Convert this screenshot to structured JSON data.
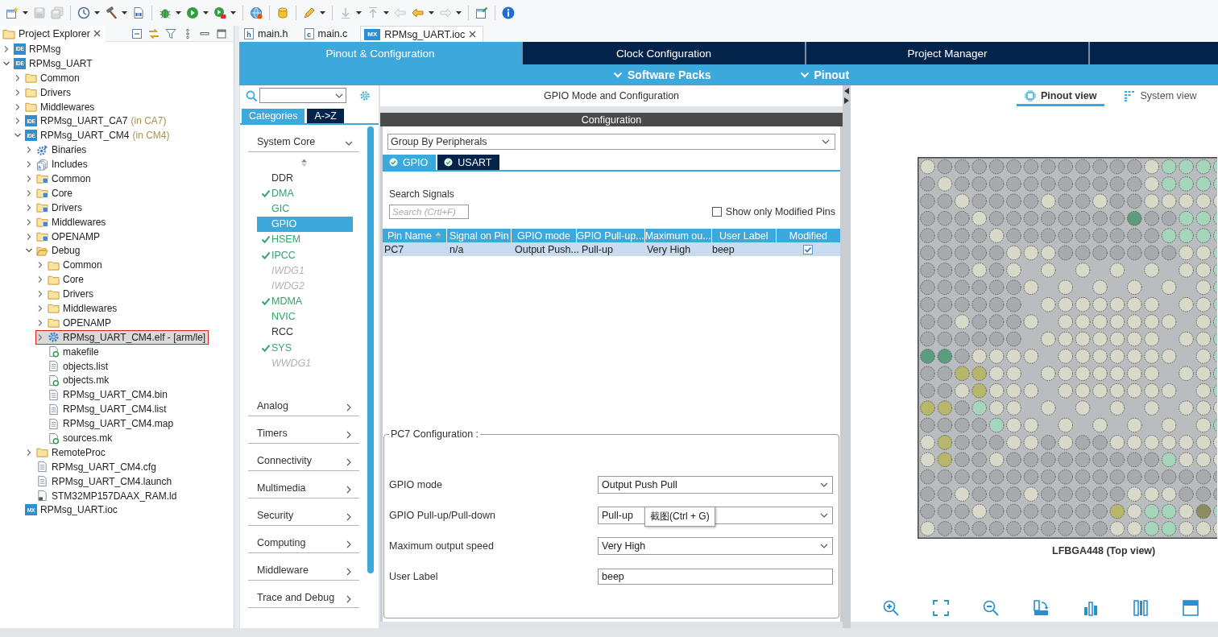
{
  "toolbar": [
    {
      "kind": "new",
      "dropdown": true,
      "disabled": false
    },
    {
      "kind": "save",
      "dropdown": false,
      "disabled": true
    },
    {
      "kind": "save-all",
      "dropdown": false,
      "disabled": true
    },
    {
      "kind": "separator"
    },
    {
      "kind": "target",
      "dropdown": true,
      "disabled": false
    },
    {
      "kind": "build",
      "dropdown": true,
      "disabled": false
    },
    {
      "kind": "binary",
      "dropdown": false,
      "disabled": false
    },
    {
      "kind": "separator"
    },
    {
      "kind": "debug",
      "dropdown": true,
      "disabled": false
    },
    {
      "kind": "run",
      "dropdown": true,
      "disabled": false
    },
    {
      "kind": "external",
      "dropdown": true,
      "disabled": false
    },
    {
      "kind": "separator"
    },
    {
      "kind": "globe",
      "dropdown": false,
      "disabled": false
    },
    {
      "kind": "separator"
    },
    {
      "kind": "mount",
      "dropdown": false,
      "disabled": false
    },
    {
      "kind": "separator"
    },
    {
      "kind": "wand",
      "dropdown": true,
      "disabled": false
    },
    {
      "kind": "separator"
    },
    {
      "kind": "step-down",
      "dropdown": true,
      "disabled": true
    },
    {
      "kind": "step-up",
      "dropdown": true,
      "disabled": true
    },
    {
      "kind": "back-edit",
      "dropdown": false,
      "disabled": true
    },
    {
      "kind": "back",
      "dropdown": true,
      "disabled": false
    },
    {
      "kind": "forward",
      "dropdown": true,
      "disabled": true
    },
    {
      "kind": "separator"
    },
    {
      "kind": "window",
      "dropdown": false,
      "disabled": false
    },
    {
      "kind": "separator"
    },
    {
      "kind": "info",
      "dropdown": false,
      "disabled": false
    }
  ],
  "explorer": {
    "title": "Project Explorer",
    "items": [
      {
        "label": "RPMsg",
        "kind": "project",
        "badge": "IDE",
        "expanded": false,
        "selected": false,
        "outlined": false
      },
      {
        "label": "RPMsg_UART",
        "kind": "project",
        "badge": "IDE",
        "expanded": true,
        "selected": false,
        "outlined": false,
        "children": [
          {
            "label": "Common",
            "kind": "folder",
            "expanded": false,
            "selected": false,
            "outlined": false
          },
          {
            "label": "Drivers",
            "kind": "folder",
            "expanded": false,
            "selected": false,
            "outlined": false
          },
          {
            "label": "Middlewares",
            "kind": "folder",
            "expanded": false,
            "selected": false,
            "outlined": false
          },
          {
            "label": "RPMsg_UART_CA7",
            "note": "(in CA7)",
            "kind": "project",
            "badge": "IDE",
            "expanded": false,
            "selected": false,
            "outlined": false
          },
          {
            "label": "RPMsg_UART_CM4",
            "note": "(in CM4)",
            "kind": "project",
            "badge": "IDE",
            "expanded": true,
            "selected": false,
            "outlined": false,
            "children": [
              {
                "label": "Binaries",
                "kind": "binaries",
                "expanded": false,
                "selected": false,
                "outlined": false
              },
              {
                "label": "Includes",
                "kind": "includes",
                "expanded": false,
                "selected": false,
                "outlined": false
              },
              {
                "label": "Common",
                "kind": "source-folder",
                "expanded": false,
                "selected": false,
                "outlined": false
              },
              {
                "label": "Core",
                "kind": "source-folder",
                "expanded": false,
                "selected": false,
                "outlined": false
              },
              {
                "label": "Drivers",
                "kind": "source-folder",
                "expanded": false,
                "selected": false,
                "outlined": false
              },
              {
                "label": "Middlewares",
                "kind": "source-folder",
                "expanded": false,
                "selected": false,
                "outlined": false
              },
              {
                "label": "OPENAMP",
                "kind": "source-folder",
                "expanded": false,
                "selected": false,
                "outlined": false
              },
              {
                "label": "Debug",
                "kind": "folder",
                "expanded": true,
                "selected": false,
                "outlined": false,
                "children": [
                  {
                    "label": "Common",
                    "kind": "folder",
                    "expanded": false,
                    "selected": false,
                    "outlined": false
                  },
                  {
                    "label": "Core",
                    "kind": "folder",
                    "expanded": false,
                    "selected": false,
                    "outlined": false
                  },
                  {
                    "label": "Drivers",
                    "kind": "folder",
                    "expanded": false,
                    "selected": false,
                    "outlined": false
                  },
                  {
                    "label": "Middlewares",
                    "kind": "folder",
                    "expanded": false,
                    "selected": false,
                    "outlined": false
                  },
                  {
                    "label": "OPENAMP",
                    "kind": "folder",
                    "expanded": false,
                    "selected": false,
                    "outlined": false
                  },
                  {
                    "label": "RPMsg_UART_CM4.elf - [arm/le]",
                    "kind": "binary",
                    "expanded": false,
                    "selected": true,
                    "outlined": true
                  },
                  {
                    "label": "makefile",
                    "kind": "make-file",
                    "expanded": false,
                    "selected": false,
                    "outlined": false
                  },
                  {
                    "label": "objects.list",
                    "kind": "text-file",
                    "expanded": false,
                    "selected": false,
                    "outlined": false
                  },
                  {
                    "label": "objects.mk",
                    "kind": "make-file",
                    "expanded": false,
                    "selected": false,
                    "outlined": false
                  },
                  {
                    "label": "RPMsg_UART_CM4.bin",
                    "kind": "text-file",
                    "expanded": false,
                    "selected": false,
                    "outlined": false
                  },
                  {
                    "label": "RPMsg_UART_CM4.list",
                    "kind": "text-file",
                    "expanded": false,
                    "selected": false,
                    "outlined": false
                  },
                  {
                    "label": "RPMsg_UART_CM4.map",
                    "kind": "text-file",
                    "expanded": false,
                    "selected": false,
                    "outlined": false
                  },
                  {
                    "label": "sources.mk",
                    "kind": "make-file",
                    "expanded": false,
                    "selected": false,
                    "outlined": false
                  }
                ]
              },
              {
                "label": "RemoteProc",
                "kind": "folder",
                "expanded": false,
                "selected": false,
                "outlined": false
              },
              {
                "label": "RPMsg_UART_CM4.cfg",
                "kind": "text-file",
                "expanded": false,
                "selected": false,
                "outlined": false
              },
              {
                "label": "RPMsg_UART_CM4.launch",
                "kind": "text-file",
                "expanded": false,
                "selected": false,
                "outlined": false
              },
              {
                "label": "STM32MP157DAAX_RAM.ld",
                "kind": "linker-file",
                "expanded": false,
                "selected": false,
                "outlined": false
              }
            ]
          },
          {
            "label": "RPMsg_UART.ioc",
            "kind": "mx-file",
            "badge": "MX",
            "expanded": false,
            "selected": false,
            "outlined": false
          }
        ]
      }
    ]
  },
  "editor_tabs": [
    {
      "label": "main.h",
      "kind": "doc",
      "badge": "h",
      "selected": false
    },
    {
      "label": "main.c",
      "kind": "doc",
      "badge": "c",
      "selected": false
    },
    {
      "label": "RPMsg_UART.ioc",
      "kind": "tile",
      "badge": "MX",
      "selected": true
    }
  ],
  "perspective_tabs": [
    {
      "label": "Pinout & Configuration",
      "selected": true
    },
    {
      "label": "Clock Configuration",
      "selected": false
    },
    {
      "label": "Project Manager",
      "selected": false
    }
  ],
  "sub_menu": [
    {
      "label": "Software Packs"
    },
    {
      "label": "Pinout"
    }
  ],
  "categories": {
    "tabs": [
      {
        "label": "Categories",
        "selected": true
      },
      {
        "label": "A->Z",
        "selected": false
      }
    ],
    "groups": [
      {
        "label": "System Core",
        "expanded": true,
        "items": [
          {
            "label": "DDR",
            "configured": false,
            "disabled": false,
            "checked": false,
            "selected": false
          },
          {
            "label": "DMA",
            "configured": true,
            "disabled": false,
            "checked": true,
            "selected": false
          },
          {
            "label": "GIC",
            "configured": true,
            "disabled": false,
            "checked": false,
            "selected": false
          },
          {
            "label": "GPIO",
            "configured": true,
            "disabled": false,
            "checked": false,
            "selected": true
          },
          {
            "label": "HSEM",
            "configured": true,
            "disabled": false,
            "checked": true,
            "selected": false
          },
          {
            "label": "IPCC",
            "configured": true,
            "disabled": false,
            "checked": true,
            "selected": false
          },
          {
            "label": "IWDG1",
            "configured": false,
            "disabled": true,
            "checked": false,
            "selected": false
          },
          {
            "label": "IWDG2",
            "configured": false,
            "disabled": true,
            "checked": false,
            "selected": false
          },
          {
            "label": "MDMA",
            "configured": true,
            "disabled": false,
            "checked": true,
            "selected": false
          },
          {
            "label": "NVIC",
            "configured": true,
            "disabled": false,
            "checked": false,
            "selected": false
          },
          {
            "label": "RCC",
            "configured": false,
            "disabled": false,
            "checked": false,
            "selected": false
          },
          {
            "label": "SYS",
            "configured": true,
            "disabled": false,
            "checked": true,
            "selected": false
          },
          {
            "label": "WWDG1",
            "configured": false,
            "disabled": true,
            "checked": false,
            "selected": false
          }
        ]
      },
      {
        "label": "Analog",
        "expanded": false
      },
      {
        "label": "Timers",
        "expanded": false
      },
      {
        "label": "Connectivity",
        "expanded": false
      },
      {
        "label": "Multimedia",
        "expanded": false
      },
      {
        "label": "Security",
        "expanded": false
      },
      {
        "label": "Computing",
        "expanded": false
      },
      {
        "label": "Middleware",
        "expanded": false
      },
      {
        "label": "Trace and Debug",
        "expanded": false
      }
    ]
  },
  "mode_panel": {
    "title": "GPIO Mode and Configuration"
  },
  "configuration": {
    "title": "Configuration",
    "group_by": "Group By Peripherals",
    "tabs": [
      {
        "label": "GPIO",
        "checked": true,
        "selected": true
      },
      {
        "label": "USART",
        "checked": true,
        "selected": false
      }
    ],
    "search_label": "Search Signals",
    "search": {
      "placeholder": "Search (Crtl+F)"
    },
    "modified_only": {
      "label": "Show only Modified Pins",
      "checked": false
    },
    "table": {
      "columns": [
        {
          "label": "Pin Name",
          "sorted": true
        },
        {
          "label": "Signal on Pin",
          "sorted": false
        },
        {
          "label": "GPIO mode",
          "sorted": false
        },
        {
          "label": "GPIO Pull-up...",
          "sorted": false
        },
        {
          "label": "Maximum ou...",
          "sorted": false
        },
        {
          "label": "User Label",
          "sorted": false
        },
        {
          "label": "Modified",
          "sorted": false
        }
      ],
      "rows": [
        {
          "cells": [
            "PC7",
            "n/a",
            "Output Push...",
            "Pull-up",
            "Very High",
            "beep"
          ],
          "modified": true,
          "selected": true
        }
      ]
    },
    "pin_config": {
      "title": "PC7 Configuration :",
      "fields": [
        {
          "label": "GPIO mode",
          "kind": "select",
          "value": "Output Push Pull"
        },
        {
          "label": "GPIO Pull-up/Pull-down",
          "kind": "select",
          "value": "Pull-up"
        },
        {
          "label": "Maximum output speed",
          "kind": "select",
          "value": "Very High"
        },
        {
          "label": "User Label",
          "kind": "text",
          "value": "beep"
        }
      ],
      "tooltip": "截图(Ctrl + G)"
    }
  },
  "pinout": {
    "tabs": [
      {
        "label": "Pinout view",
        "kind": "chip",
        "selected": true
      },
      {
        "label": "System view",
        "kind": "grid",
        "selected": false
      }
    ],
    "ball_rows": [
      [
        {
          "color": "#d9d9c9"
        },
        {
          "color": "#a7abae"
        },
        {
          "color": "#a7abae"
        },
        {
          "color": "#a7abae"
        },
        {
          "color": "#a7abae"
        },
        {
          "color": "#a7abae"
        },
        {
          "color": "#a7abae"
        },
        {
          "color": "#a7abae"
        },
        {
          "color": "#a7abae"
        },
        {
          "color": "#a7abae"
        },
        {
          "color": "#a7abae"
        },
        {
          "color": "#a7abae"
        },
        {
          "color": "#a7abae"
        },
        {
          "color": "#d9d9c9"
        },
        {
          "color": "#a5d6bb"
        },
        {
          "color": "#a5d6bb"
        },
        {
          "color": "#a5d6bb"
        },
        {
          "color": "#a5d6bb"
        }
      ],
      [
        {
          "color": "#a7abae"
        },
        {
          "color": "#d9d9c9"
        },
        {
          "color": "#a7abae"
        },
        {
          "color": "#a7abae"
        },
        {
          "color": "#a7abae"
        },
        {
          "color": "#a7abae"
        },
        {
          "color": "#a7abae"
        },
        {
          "color": "#a7abae"
        },
        {
          "color": "#a7abae"
        },
        {
          "color": "#a7abae"
        },
        {
          "color": "#a7abae"
        },
        {
          "color": "#a7abae"
        },
        {
          "color": "#a7abae"
        },
        {
          "color": "#d9d9c9"
        },
        {
          "color": "#a5d6bb"
        },
        {
          "color": "#a5d6bb"
        },
        {
          "color": "#a5d6bb"
        },
        {
          "color": "#a5d6bb"
        }
      ],
      [
        {
          "color": "#a7abae"
        },
        {
          "color": "#a7abae"
        },
        {
          "color": "#d9d9c9"
        },
        {
          "color": "#a7abae"
        },
        {
          "color": "#a7abae"
        },
        {
          "color": "#a7abae"
        },
        {
          "color": "#a7abae"
        },
        {
          "color": "#d9d9c9"
        },
        {
          "color": "#a7abae"
        },
        {
          "color": "#a7abae"
        },
        {
          "color": "#d9d9c9"
        },
        {
          "color": "#a7abae"
        },
        {
          "color": "#a7abae"
        },
        {
          "color": "#d9d9c9"
        },
        {
          "color": "#d9d9c9"
        },
        {
          "color": "#d9d9c9"
        },
        {
          "color": "#d9d9c9"
        },
        {
          "color": "#d9d9c9"
        }
      ],
      [
        {
          "color": "#a7abae"
        },
        {
          "color": "#a7abae"
        },
        {
          "color": "#a7abae"
        },
        {
          "color": "#d9d9c9"
        },
        {
          "color": "#a7abae"
        },
        {
          "color": "#a7abae"
        },
        {
          "color": "#a7abae"
        },
        {
          "color": "#a7abae"
        },
        {
          "color": "#a7abae"
        },
        {
          "color": "#a7abae"
        },
        {
          "color": "#a7abae"
        },
        {
          "color": "#a7abae"
        },
        {
          "color": "#5c9c7e"
        },
        {
          "color": "#a7abae"
        },
        {
          "color": "#a7abae"
        },
        {
          "color": "#a5d6bb"
        },
        {
          "color": "#a5d6bb"
        },
        {
          "color": "#a5d6bb"
        }
      ],
      [
        {
          "color": "#a7abae"
        },
        {
          "color": "#a7abae"
        },
        {
          "color": "#a7abae"
        },
        {
          "color": "#a7abae"
        },
        {
          "color": "#d9d9c9"
        },
        {
          "color": "#a7abae"
        },
        {
          "color": "#a7abae"
        },
        {
          "color": "#a7abae"
        },
        {
          "color": "#a7abae"
        },
        {
          "color": "#a7abae"
        },
        {
          "color": "#a7abae"
        },
        {
          "color": "#a7abae"
        },
        {
          "color": "#a7abae"
        },
        {
          "color": "#a7abae"
        },
        {
          "color": "#a5d6bb"
        },
        {
          "color": "#a5d6bb"
        },
        {
          "color": "#a5d6bb"
        },
        {
          "color": "#a5d6bb"
        }
      ],
      [
        {
          "color": "#a7abae"
        },
        {
          "color": "#a7abae"
        },
        {
          "color": "#a7abae"
        },
        {
          "color": "#a7abae"
        },
        {
          "color": "#a7abae"
        },
        {
          "color": "#d9d9c9"
        },
        {
          "color": "#d9d9c9"
        },
        {
          "color": "#d9d9c9"
        },
        {
          "color": "#a7abae"
        },
        {
          "color": "#a7abae"
        },
        {
          "color": "#a7abae"
        },
        {
          "color": "#a7abae"
        },
        {
          "color": "#a7abae"
        },
        {
          "color": "#a7abae"
        },
        {
          "color": "#a7abae"
        },
        {
          "color": "#d9d9c9"
        },
        {
          "color": "#d9d9c9"
        },
        {
          "color": "#a5d6bb"
        }
      ],
      [
        {
          "color": "#a7abae"
        },
        {
          "color": "#a7abae"
        },
        {
          "color": "#a7abae"
        },
        {
          "color": "#d9d9c9"
        },
        {
          "color": "#a7abae"
        },
        {
          "color": "#d9d9c9"
        },
        null,
        {
          "color": "#d9d9c9"
        },
        null,
        {
          "color": "#d9d9c9"
        },
        null,
        {
          "color": "#d9d9c9"
        },
        null,
        {
          "color": "#d9d9c9"
        },
        null,
        {
          "color": "#d9d9c9"
        },
        {
          "color": "#d9d9c9"
        },
        {
          "color": "#a5d6bb"
        }
      ],
      [
        {
          "color": "#a7abae"
        },
        {
          "color": "#a7abae"
        },
        {
          "color": "#a7abae"
        },
        {
          "color": "#a7abae"
        },
        {
          "color": "#a7abae"
        },
        {
          "color": "#a7abae"
        },
        {
          "color": "#d9d9c9"
        },
        null,
        {
          "color": "#d9d9c9"
        },
        null,
        {
          "color": "#d9d9c9"
        },
        null,
        {
          "color": "#d9d9c9"
        },
        null,
        {
          "color": "#d9d9c9"
        },
        null,
        {
          "color": "#d9d9c9"
        },
        {
          "color": "#a5d6bb"
        }
      ],
      [
        {
          "color": "#a7abae"
        },
        {
          "color": "#a7abae"
        },
        {
          "color": "#a7abae"
        },
        {
          "color": "#a7abae"
        },
        {
          "color": "#a7abae"
        },
        {
          "color": "#a7abae"
        },
        null,
        {
          "color": "#d9d9c9"
        },
        {
          "color": "#d9d9c9"
        },
        {
          "color": "#d9d9c9"
        },
        {
          "color": "#d9d9c9"
        },
        {
          "color": "#d9d9c9"
        },
        {
          "color": "#d9d9c9"
        },
        {
          "color": "#d9d9c9"
        },
        null,
        {
          "color": "#d9d9c9"
        },
        {
          "color": "#d9d9c9"
        },
        {
          "color": "#a5d6bb"
        }
      ],
      [
        {
          "color": "#a7abae"
        },
        {
          "color": "#a7abae"
        },
        {
          "color": "#d9d9c9"
        },
        {
          "color": "#a7abae"
        },
        {
          "color": "#a7abae"
        },
        {
          "color": "#a7abae"
        },
        {
          "color": "#d9d9c9"
        },
        null,
        {
          "color": "#d9d9c9"
        },
        {
          "color": "#d9d9c9"
        },
        {
          "color": "#d9d9c9"
        },
        {
          "color": "#d9d9c9"
        },
        {
          "color": "#d9d9c9"
        },
        {
          "color": "#d9d9c9"
        },
        {
          "color": "#d9d9c9"
        },
        null,
        {
          "color": "#d9d9c9"
        },
        {
          "color": "#a5d6bb"
        }
      ],
      [
        {
          "color": "#a7abae"
        },
        {
          "color": "#a7abae"
        },
        {
          "color": "#a7abae"
        },
        {
          "color": "#a7abae"
        },
        {
          "color": "#a7abae"
        },
        {
          "color": "#a7abae"
        },
        null,
        {
          "color": "#d9d9c9"
        },
        {
          "color": "#d9d9c9"
        },
        {
          "color": "#d9d9c9"
        },
        {
          "color": "#d9d9c9"
        },
        {
          "color": "#d9d9c9"
        },
        {
          "color": "#d9d9c9"
        },
        {
          "color": "#d9d9c9"
        },
        null,
        {
          "color": "#d9d9c9"
        },
        {
          "color": "#d9d9c9"
        },
        {
          "color": "#a5d6bb"
        }
      ],
      [
        {
          "color": "#5c9c7e"
        },
        {
          "color": "#5c9c7e"
        },
        {
          "color": "#a7abae"
        },
        {
          "color": "#d9d9c9"
        },
        {
          "color": "#d9d9c9"
        },
        {
          "color": "#d9d9c9"
        },
        {
          "color": "#d9d9c9"
        },
        null,
        {
          "color": "#d9d9c9"
        },
        {
          "color": "#d9d9c9"
        },
        {
          "color": "#d9d9c9"
        },
        {
          "color": "#d9d9c9"
        },
        {
          "color": "#d9d9c9"
        },
        {
          "color": "#d9d9c9"
        },
        {
          "color": "#d9d9c9"
        },
        null,
        {
          "color": "#d9d9c9"
        },
        {
          "color": "#a5d6bb"
        }
      ],
      [
        {
          "color": "#a7abae"
        },
        {
          "color": "#a7abae"
        },
        {
          "color": "#b7b66b"
        },
        {
          "color": "#b7b66b"
        },
        {
          "color": "#d9d9c9"
        },
        {
          "color": "#d9d9c9"
        },
        null,
        {
          "color": "#d9d9c9"
        },
        {
          "color": "#d9d9c9"
        },
        {
          "color": "#d9d9c9"
        },
        {
          "color": "#d9d9c9"
        },
        {
          "color": "#d9d9c9"
        },
        {
          "color": "#d9d9c9"
        },
        {
          "color": "#d9d9c9"
        },
        null,
        {
          "color": "#d9d9c9"
        },
        {
          "color": "#d9d9c9"
        },
        {
          "color": "#a5d6bb"
        }
      ],
      [
        {
          "color": "#a7abae"
        },
        {
          "color": "#a7abae"
        },
        {
          "color": "#d9d9c9"
        },
        {
          "color": "#b7b66b"
        },
        {
          "color": "#d9d9c9"
        },
        {
          "color": "#d9d9c9"
        },
        {
          "color": "#d9d9c9"
        },
        null,
        {
          "color": "#d9d9c9"
        },
        {
          "color": "#d9d9c9"
        },
        {
          "color": "#d9d9c9"
        },
        {
          "color": "#d9d9c9"
        },
        {
          "color": "#d9d9c9"
        },
        {
          "color": "#d9d9c9"
        },
        {
          "color": "#d9d9c9"
        },
        null,
        {
          "color": "#d9d9c9"
        },
        {
          "color": "#a5d6bb"
        }
      ],
      [
        {
          "color": "#b7b66b"
        },
        {
          "color": "#b7b66b"
        },
        {
          "color": "#a7abae"
        },
        {
          "color": "#a5d6bb"
        },
        {
          "color": "#d9d9c9"
        },
        {
          "color": "#d9d9c9"
        },
        null,
        {
          "color": "#d9d9c9"
        },
        null,
        {
          "color": "#d9d9c9"
        },
        null,
        {
          "color": "#d9d9c9"
        },
        null,
        {
          "color": "#d9d9c9"
        },
        null,
        {
          "color": "#d9d9c9"
        },
        {
          "color": "#d9d9c9"
        },
        {
          "color": "#d9d9c9"
        }
      ],
      [
        {
          "color": "#a7abae"
        },
        {
          "color": "#a7abae"
        },
        {
          "color": "#a7abae"
        },
        {
          "color": "#a7abae"
        },
        {
          "color": "#a5d6bb"
        },
        {
          "color": "#d9d9c9"
        },
        {
          "color": "#d9d9c9"
        },
        null,
        {
          "color": "#d9d9c9"
        },
        null,
        {
          "color": "#d9d9c9"
        },
        null,
        {
          "color": "#d9d9c9"
        },
        null,
        {
          "color": "#d9d9c9"
        },
        null,
        {
          "color": "#d9d9c9"
        },
        {
          "color": "#a5d6bb"
        }
      ],
      [
        {
          "color": "#d9d9c9"
        },
        {
          "color": "#b7b66b"
        },
        {
          "color": "#a7abae"
        },
        {
          "color": "#a7abae"
        },
        {
          "color": "#a7abae"
        },
        {
          "color": "#d9d9c9"
        },
        {
          "color": "#d9d9c9"
        },
        {
          "color": "#a7abae"
        },
        {
          "color": "#d9d9c9"
        },
        {
          "color": "#a7abae"
        },
        {
          "color": "#a7abae"
        },
        {
          "color": "#d9d9c9"
        },
        {
          "color": "#d9d9c9"
        },
        {
          "color": "#d9d9c9"
        },
        {
          "color": "#d9d9c9"
        },
        {
          "color": "#d9d9c9"
        },
        {
          "color": "#d9d9c9"
        },
        {
          "color": "#d9d9c9"
        }
      ],
      [
        {
          "color": "#d9d9c9"
        },
        {
          "color": "#b7b66b"
        },
        {
          "color": "#a7abae"
        },
        {
          "color": "#a7abae"
        },
        {
          "color": "#d9d9c9"
        },
        {
          "color": "#a7abae"
        },
        {
          "color": "#a7abae"
        },
        {
          "color": "#a7abae"
        },
        {
          "color": "#a7abae"
        },
        {
          "color": "#a7abae"
        },
        {
          "color": "#a7abae"
        },
        {
          "color": "#a7abae"
        },
        {
          "color": "#a7abae"
        },
        {
          "color": "#a7abae"
        },
        {
          "color": "#a5d6bb"
        },
        {
          "color": "#d9d9c9"
        },
        {
          "color": "#d9d9c9"
        },
        {
          "color": "#d9d9c9"
        }
      ],
      [
        {
          "color": "#a7abae"
        },
        {
          "color": "#a7abae"
        },
        {
          "color": "#a7abae"
        },
        {
          "color": "#a7abae"
        },
        {
          "color": "#a7abae"
        },
        {
          "color": "#a7abae"
        },
        {
          "color": "#a7abae"
        },
        {
          "color": "#a7abae"
        },
        {
          "color": "#a7abae"
        },
        {
          "color": "#a7abae"
        },
        {
          "color": "#a7abae"
        },
        {
          "color": "#a7abae"
        },
        {
          "color": "#a7abae"
        },
        {
          "color": "#a7abae"
        },
        {
          "color": "#a7abae"
        },
        {
          "color": "#a7abae"
        },
        {
          "color": "#a7abae"
        },
        {
          "color": "#a7abae"
        }
      ],
      [
        {
          "color": "#a7abae"
        },
        {
          "color": "#a7abae"
        },
        {
          "color": "#d9d9c9"
        },
        {
          "color": "#a7abae"
        },
        {
          "color": "#a7abae"
        },
        {
          "color": "#a7abae"
        },
        {
          "color": "#d9d9c9"
        },
        {
          "color": "#a7abae"
        },
        {
          "color": "#a7abae"
        },
        {
          "color": "#a7abae"
        },
        {
          "color": "#a7abae"
        },
        {
          "color": "#a7abae"
        },
        {
          "color": "#d9d9c9"
        },
        {
          "color": "#d9d9c9"
        },
        {
          "color": "#d9d9c9"
        },
        {
          "color": "#a7abae"
        },
        {
          "color": "#a7abae"
        },
        {
          "color": "#a7abae"
        }
      ],
      [
        {
          "color": "#a7abae"
        },
        {
          "color": "#a7abae"
        },
        {
          "color": "#a7abae"
        },
        {
          "color": "#d9d9c9"
        },
        {
          "color": "#a7abae"
        },
        {
          "color": "#a7abae"
        },
        {
          "color": "#a7abae"
        },
        {
          "color": "#a7abae"
        },
        {
          "color": "#a7abae"
        },
        {
          "color": "#a7abae"
        },
        {
          "color": "#a7abae"
        },
        {
          "color": "#b7b66b"
        },
        {
          "color": "#d9d9c9"
        },
        {
          "color": "#a5d6bb"
        },
        {
          "color": "#a5d6bb"
        },
        {
          "color": "#d9d9c9"
        },
        {
          "color": "#8d8b62"
        },
        {
          "color": "#a5d6bb"
        }
      ],
      [
        {
          "color": "#d9d9c9"
        },
        {
          "color": "#a7abae"
        },
        {
          "color": "#a7abae"
        },
        {
          "color": "#a7abae"
        },
        {
          "color": "#a7abae"
        },
        {
          "color": "#a7abae"
        },
        {
          "color": "#a7abae"
        },
        {
          "color": "#a7abae"
        },
        {
          "color": "#a7abae"
        },
        {
          "color": "#a7abae"
        },
        {
          "color": "#a7abae"
        },
        {
          "color": "#d9d9c9"
        },
        {
          "color": "#d9d9c9"
        },
        {
          "color": "#a5d6bb"
        },
        {
          "color": "#a5d6bb"
        },
        {
          "color": "#d9d9c9"
        },
        {
          "color": "#d9d9c9"
        },
        {
          "color": "#d9d9c9"
        }
      ]
    ],
    "caption": "LFBGA448 (Top view)",
    "tools": [
      {
        "kind": "zoom-in"
      },
      {
        "kind": "fit"
      },
      {
        "kind": "zoom-out"
      },
      {
        "kind": "rotate"
      },
      {
        "kind": "chart"
      },
      {
        "kind": "columns"
      },
      {
        "kind": "panel"
      }
    ]
  }
}
